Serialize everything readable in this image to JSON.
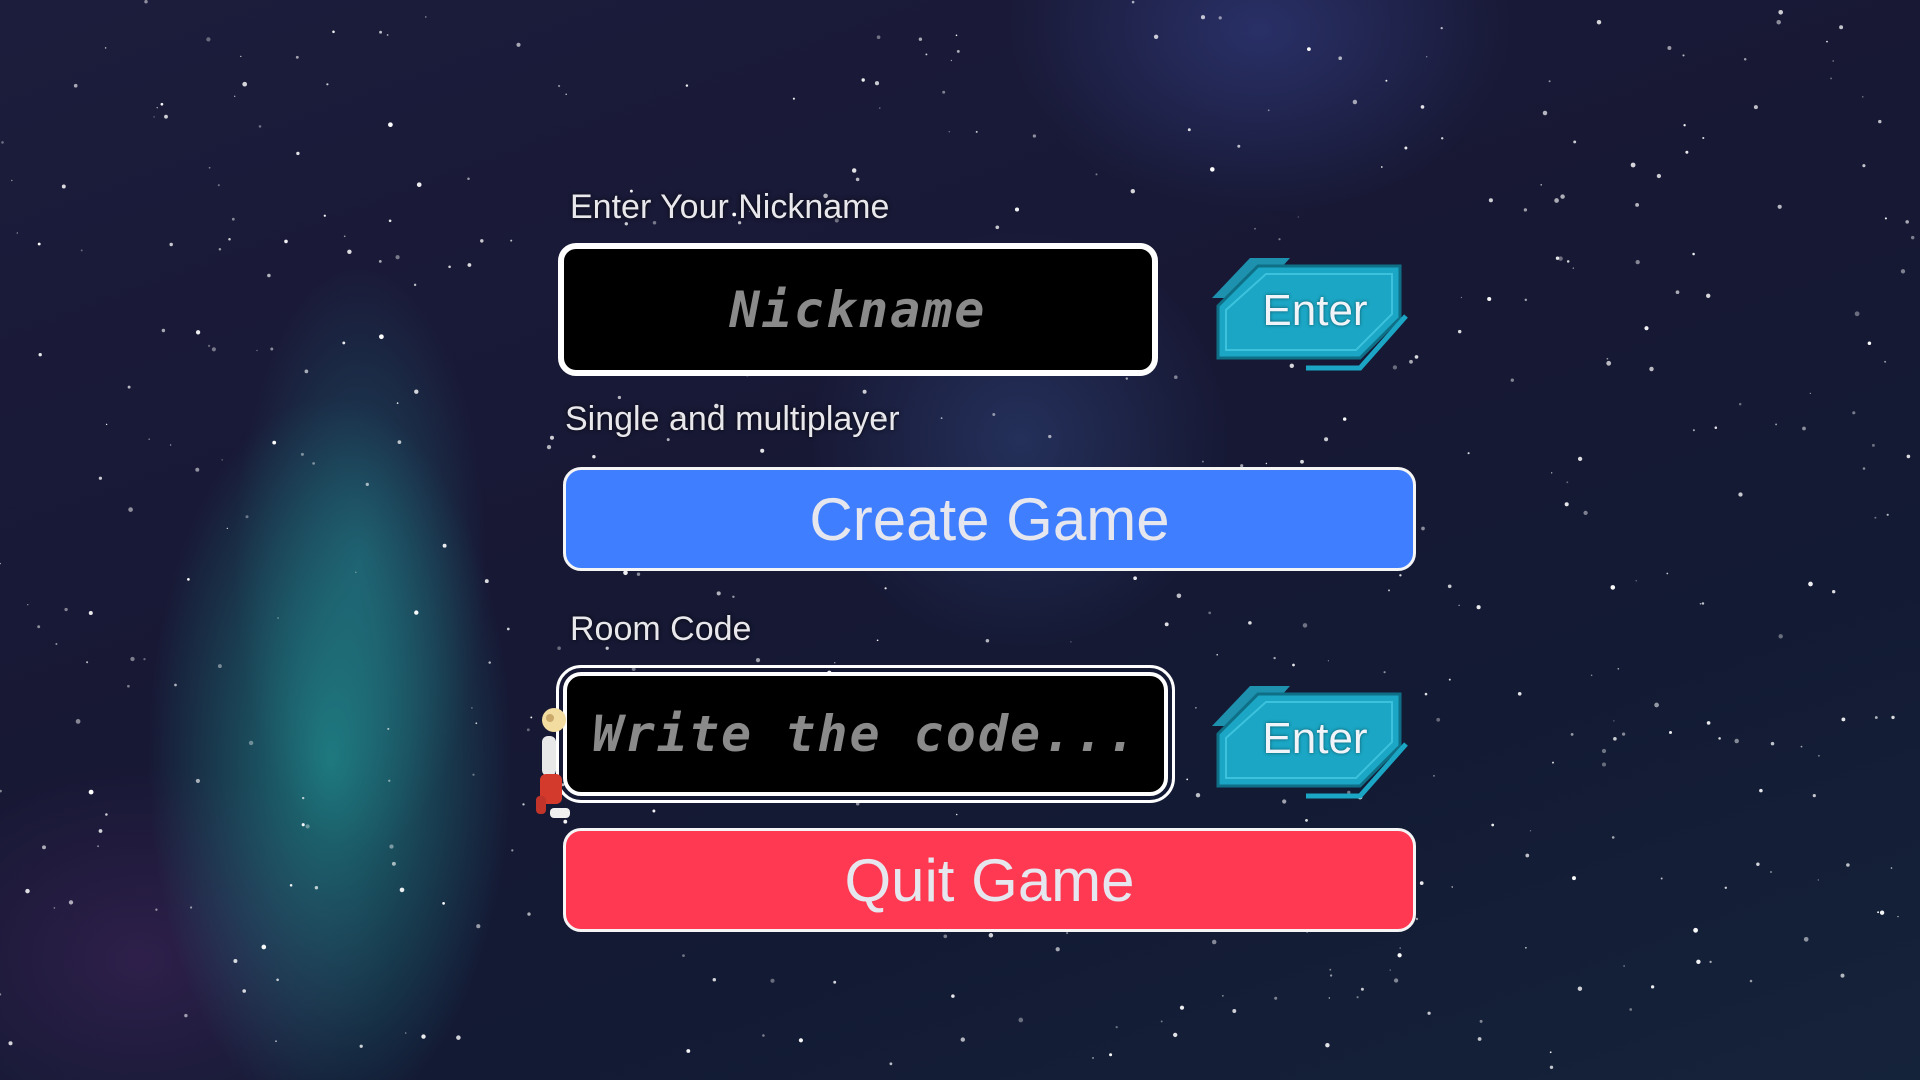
{
  "nickname": {
    "label": "Enter Your Nickname",
    "placeholder": "Nickname",
    "enter_label": "Enter"
  },
  "mode": {
    "label": "Single and multiplayer",
    "create_label": "Create Game"
  },
  "room": {
    "label": "Room Code",
    "placeholder": "Write the code...",
    "enter_label": "Enter"
  },
  "quit": {
    "label": "Quit Game"
  },
  "colors": {
    "create_button": "#3f7fff",
    "quit_button": "#ff3952",
    "enter_button": "#1aa6c4",
    "field_background": "#000000",
    "field_border": "#ffffff"
  },
  "icons": {
    "character": "astronaut-character-icon"
  }
}
